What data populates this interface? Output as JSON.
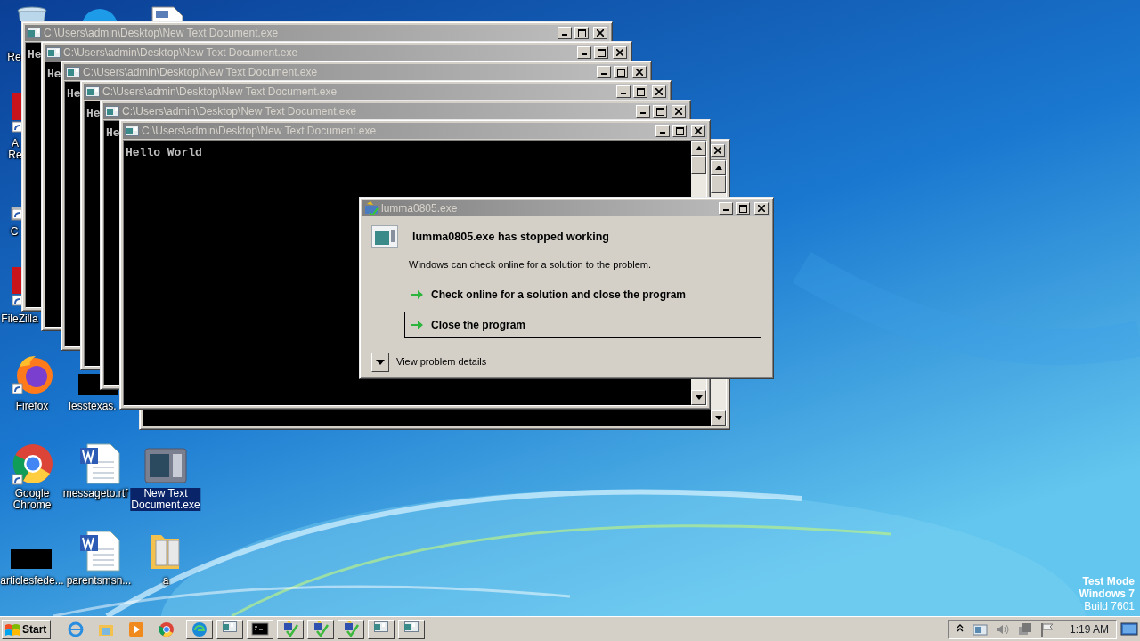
{
  "desktop_icons": [
    {
      "kind": "bin",
      "label": [
        "Re"
      ],
      "selected": false
    },
    {
      "kind": "circle"
    },
    {
      "kind": "file"
    },
    {
      "kind": "red",
      "label": [
        "A",
        "Re"
      ],
      "selected": false
    },
    {
      "kind": "shortcut",
      "label": [
        "C"
      ],
      "selected": false
    },
    {
      "kind": "red",
      "label": [
        "FileZilla"
      ],
      "selected": false
    },
    {
      "kind": "firefox",
      "label": [
        "Firefox"
      ],
      "selected": false
    },
    {
      "kind": "black",
      "label": [
        "lesstexas."
      ],
      "selected": false
    },
    {
      "kind": "chrome",
      "label": [
        "Google",
        "Chrome"
      ],
      "selected": false
    },
    {
      "kind": "word",
      "label": [
        "messageto.rtf"
      ],
      "selected": false
    },
    {
      "kind": "app",
      "label": [
        "New Text",
        "Document.exe"
      ],
      "selected": true
    },
    {
      "kind": "black",
      "label": [
        "articlesfede..."
      ],
      "selected": false
    },
    {
      "kind": "word",
      "label": [
        "parentsmsn..."
      ],
      "selected": false
    },
    {
      "kind": "folder",
      "label": [
        "a"
      ],
      "selected": false
    }
  ],
  "console_windows": [
    {
      "title": "C:\\Users\\admin\\Desktop\\New Text Document.exe",
      "output": "He",
      "covered": false
    },
    {
      "title": "C:\\Users\\admin\\Desktop\\New Text Document.exe",
      "output": "He",
      "covered": false
    },
    {
      "title": "C:\\Users\\admin\\Desktop\\New Text Document.exe",
      "output": "He",
      "covered": false
    },
    {
      "title": "C:\\Users\\admin\\Desktop\\New Text Document.exe",
      "output": "He",
      "covered": false
    },
    {
      "title": "C:\\Users\\admin\\Desktop\\New Text Document.exe",
      "output": "He",
      "covered": false
    },
    {
      "title": "C:\\Users\\admin\\Desktop\\New Text Document.exe",
      "output": "Hello World",
      "covered": false
    },
    {
      "covered": true
    }
  ],
  "error_dialog": {
    "title": "lumma0805.exe",
    "heading": "lumma0805.exe has stopped working",
    "message": "Windows can check online for a solution to the problem.",
    "options": [
      {
        "label": "Check online for a solution and close the program",
        "selected": false
      },
      {
        "label": "Close the program",
        "selected": true
      }
    ],
    "details": "View problem details"
  },
  "system_watermark": [
    {
      "text": "Test Mode",
      "bold": true
    },
    {
      "text": "Windows 7",
      "bold": true
    },
    {
      "text": "Build 7601",
      "bold": false
    }
  ],
  "taskbar": {
    "start": "Start",
    "quick_launch": [
      {
        "kind": "ie"
      },
      {
        "kind": "explorer"
      },
      {
        "kind": "media"
      },
      {
        "kind": "chrome"
      }
    ],
    "tasks": [
      {
        "kind": "edge"
      },
      {
        "kind": "console"
      },
      {
        "kind": "cmd"
      },
      {
        "kind": "check"
      },
      {
        "kind": "check"
      },
      {
        "kind": "check"
      },
      {
        "kind": "console"
      },
      {
        "kind": "console"
      }
    ],
    "tray": [
      {
        "kind": "chevron"
      },
      {
        "kind": "window"
      },
      {
        "kind": "speaker"
      },
      {
        "kind": "network"
      },
      {
        "kind": "flag"
      }
    ],
    "clock": "1:19 AM"
  }
}
